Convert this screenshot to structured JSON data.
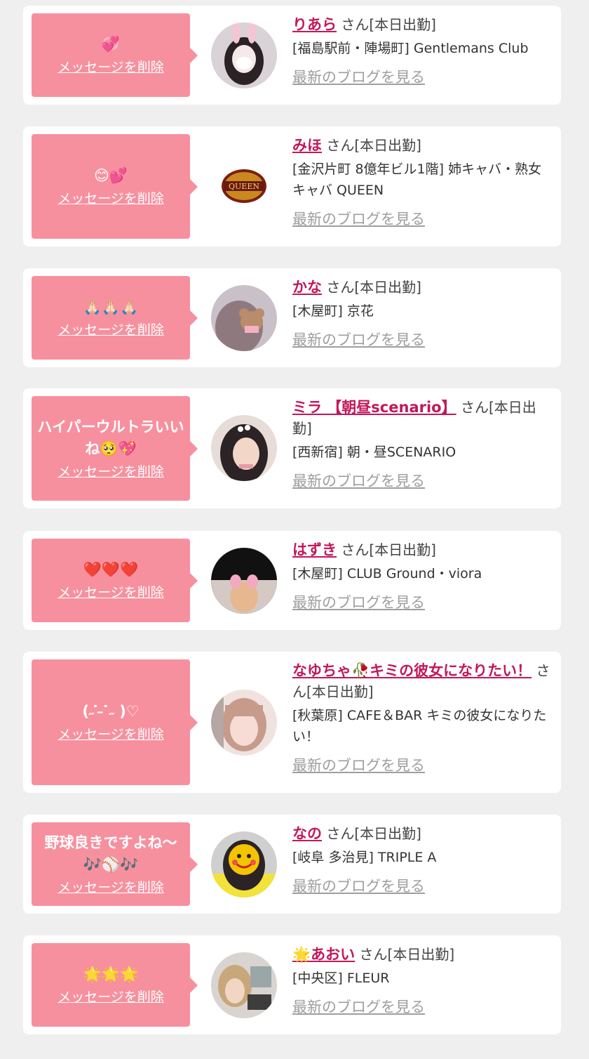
{
  "delete_label": "メッセージを削除",
  "blog_label": "最新のブログを見る",
  "suffix_label": "さん[本日出勤]",
  "cards": [
    {
      "message": "💞",
      "name": "りあら",
      "shop": "[福島駅前・陣場町] Gentlemans Club"
    },
    {
      "message": "😊💕",
      "name": "みほ",
      "shop": "[金沢片町 8億年ビル1階] 姉キャバ・熟女キャバ QUEEN"
    },
    {
      "message": "🙏🏻🙏🏻🙏🏻",
      "name": "かな",
      "shop": "[木屋町] 京花"
    },
    {
      "message": "ハイパーウルトラいいね🥺💖",
      "name": "ミラ 【朝昼scenario】",
      "shop": "[西新宿] 朝・昼SCENARIO"
    },
    {
      "message": "❤️❤️❤️",
      "name": "はずき",
      "shop": "[木屋町] CLUB Ground・viora"
    },
    {
      "message": "(˶ ̇ ̵ ̇˶ )♡",
      "name": "なゆちゃ🥀キミの彼女になりたい！",
      "shop": "[秋葉原] CAFE＆BAR キミの彼女になりたい！"
    },
    {
      "message": "野球良きですよね〜🎶⚾️🎶",
      "name": "なの",
      "shop": "[岐阜 多治見] TRIPLE A"
    },
    {
      "message": "🌟🌟🌟",
      "name": "🌟あおい",
      "shop": "[中央区] FLEUR"
    }
  ]
}
